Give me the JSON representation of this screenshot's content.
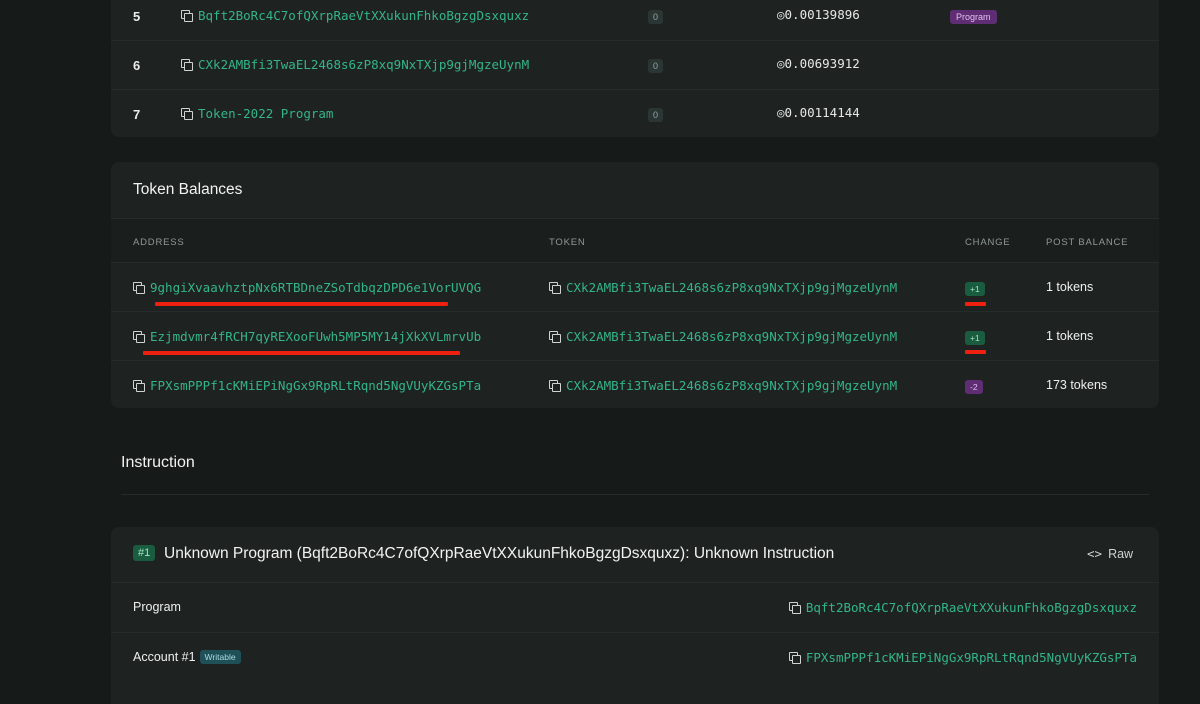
{
  "accounts": [
    {
      "index": "5",
      "address": "Bqft2BoRc4C7ofQXrpRaeVtXXukunFhkoBgzgDsxquxz",
      "change": "0",
      "balance": "◎0.00139896",
      "tag": "Program"
    },
    {
      "index": "6",
      "address": "CXk2AMBfi3TwaEL2468s6zP8xq9NxTXjp9gjMgzeUynM",
      "change": "0",
      "balance": "◎0.00693912",
      "tag": ""
    },
    {
      "index": "7",
      "address": "Token-2022 Program",
      "change": "0",
      "balance": "◎0.00114144",
      "tag": ""
    }
  ],
  "token_balances": {
    "title": "Token Balances",
    "headers": {
      "address": "ADDRESS",
      "token": "TOKEN",
      "change": "CHANGE",
      "post_balance": "POST BALANCE"
    },
    "rows": [
      {
        "address": "9ghgiXvaavhztpNx6RTBDneZSoTdbqzDPD6e1VorUVQG",
        "token": "CXk2AMBfi3TwaEL2468s6zP8xq9NxTXjp9gjMgzeUynM",
        "change": "+1",
        "post": "1 tokens"
      },
      {
        "address": "Ezjmdvmr4fRCH7qyREXooFUwh5MP5MY14jXkXVLmrvUb",
        "token": "CXk2AMBfi3TwaEL2468s6zP8xq9NxTXjp9gjMgzeUynM",
        "change": "+1",
        "post": "1 tokens"
      },
      {
        "address": "FPXsmPPPf1cKMiEPiNgGx9RpRLtRqnd5NgVUyKZGsPTa",
        "token": "CXk2AMBfi3TwaEL2468s6zP8xq9NxTXjp9gjMgzeUynM",
        "change": "-2",
        "post": "173 tokens"
      }
    ]
  },
  "instruction": {
    "section_title": "Instruction",
    "badge": "#1",
    "title": "Unknown Program (Bqft2BoRc4C7ofQXrpRaeVtXXukunFhkoBgzgDsxquxz): Unknown Instruction",
    "raw_label": "Raw",
    "rows": [
      {
        "label": "Program",
        "pill": "",
        "value": "Bqft2BoRc4C7ofQXrpRaeVtXXukunFhkoBgzgDsxquxz"
      },
      {
        "label": "Account #1",
        "pill": "Writable",
        "value": "FPXsmPPPf1cKMiEPiNgGx9RpRLtRqnd5NgVUyKZGsPTa"
      }
    ]
  },
  "colors": {
    "background": "#161a19",
    "card": "#1e2322",
    "link_green": "#33b48a",
    "annotation_red": "#ee2111"
  }
}
